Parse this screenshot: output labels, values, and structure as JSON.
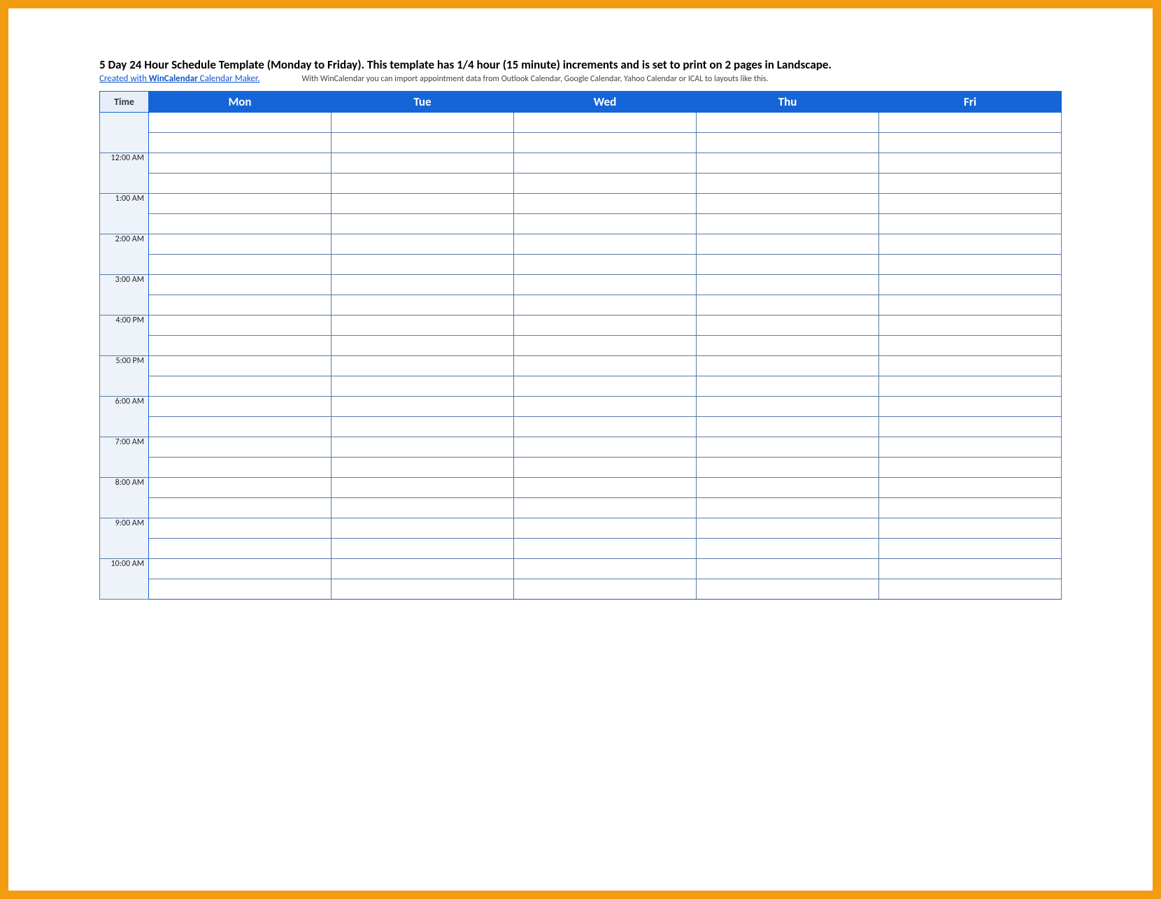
{
  "header": {
    "title": "5 Day 24 Hour Schedule Template (Monday to Friday).  This template has 1/4 hour (15 minute) increments and is set to print on 2 pages in Landscape.",
    "link_prefix": "Created with ",
    "link_bold": "WinCalendar",
    "link_suffix": " Calendar Maker.",
    "sub_desc": "With WinCalendar you can import appointment data from Outlook Calendar, Google Calendar, Yahoo Calendar or ICAL to layouts like this."
  },
  "table": {
    "time_header": "Time",
    "days": [
      "Mon",
      "Tue",
      "Wed",
      "Thu",
      "Fri"
    ],
    "hours": [
      {
        "label": "",
        "rows": 2
      },
      {
        "label": "12:00 AM",
        "rows": 2
      },
      {
        "label": "1:00 AM",
        "rows": 2
      },
      {
        "label": "2:00 AM",
        "rows": 2
      },
      {
        "label": "3:00 AM",
        "rows": 2
      },
      {
        "label": "4:00 PM",
        "rows": 2
      },
      {
        "label": "5:00 PM",
        "rows": 2
      },
      {
        "label": "6:00 AM",
        "rows": 2
      },
      {
        "label": "7:00 AM",
        "rows": 2
      },
      {
        "label": "8:00 AM",
        "rows": 2
      },
      {
        "label": "9:00 AM",
        "rows": 2
      },
      {
        "label": "10:00 AM",
        "rows": 2
      }
    ]
  }
}
